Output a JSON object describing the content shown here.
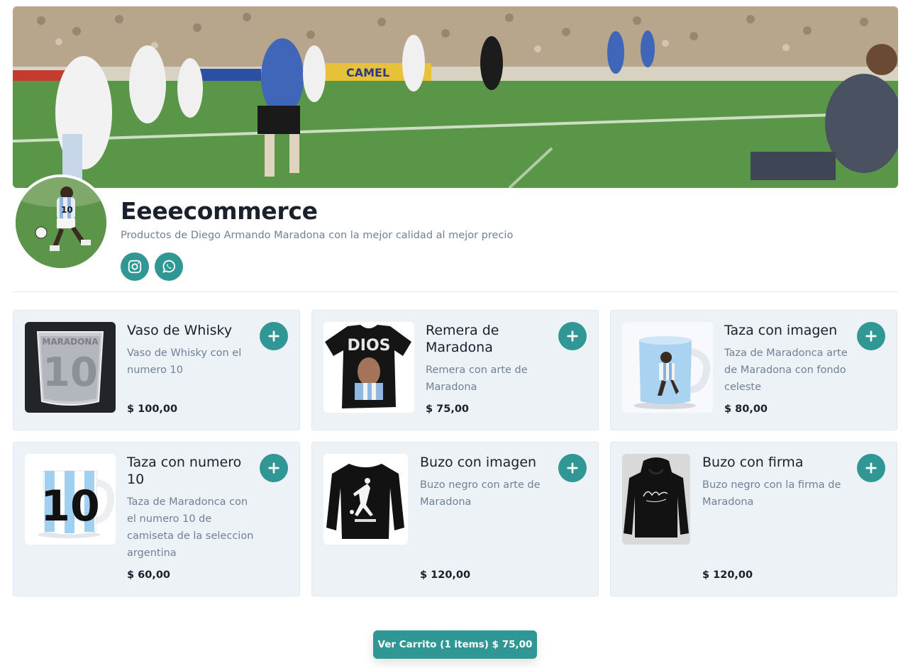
{
  "store": {
    "title": "Eeeecommerce",
    "subtitle": "Productos de Diego Armando Maradona con la mejor calidad al mejor precio"
  },
  "banner": {
    "billboard_text": "CAMEL"
  },
  "social": [
    {
      "icon": "instagram-icon"
    },
    {
      "icon": "whatsapp-icon"
    }
  ],
  "products": [
    {
      "name": "Vaso de Whisky",
      "description": "Vaso de Whisky con el numero 10",
      "price": "$ 100,00",
      "image_text": "MARADONA",
      "image_number": "10"
    },
    {
      "name": "Remera de Maradona",
      "description": "Remera con arte de Maradona",
      "price": "$ 75,00",
      "image_text": "DIOS"
    },
    {
      "name": "Taza con imagen",
      "description": "Taza de Maradonca arte de Maradona con fondo celeste",
      "price": "$ 80,00"
    },
    {
      "name": "Taza con numero 10",
      "description": "Taza de Maradonca con el numero 10 de camiseta de la seleccion argentina",
      "price": "$ 60,00",
      "image_number": "10"
    },
    {
      "name": "Buzo con imagen",
      "description": "Buzo negro con arte de Maradona",
      "price": "$ 120,00"
    },
    {
      "name": "Buzo con firma",
      "description": "Buzo negro con la firma de Maradona",
      "price": "$ 120,00"
    }
  ],
  "cart": {
    "label": "Ver Carrito (1 items) $ 75,00"
  },
  "colors": {
    "accent": "#319795",
    "card_bg": "#edf2f7",
    "muted_text": "#718096"
  }
}
